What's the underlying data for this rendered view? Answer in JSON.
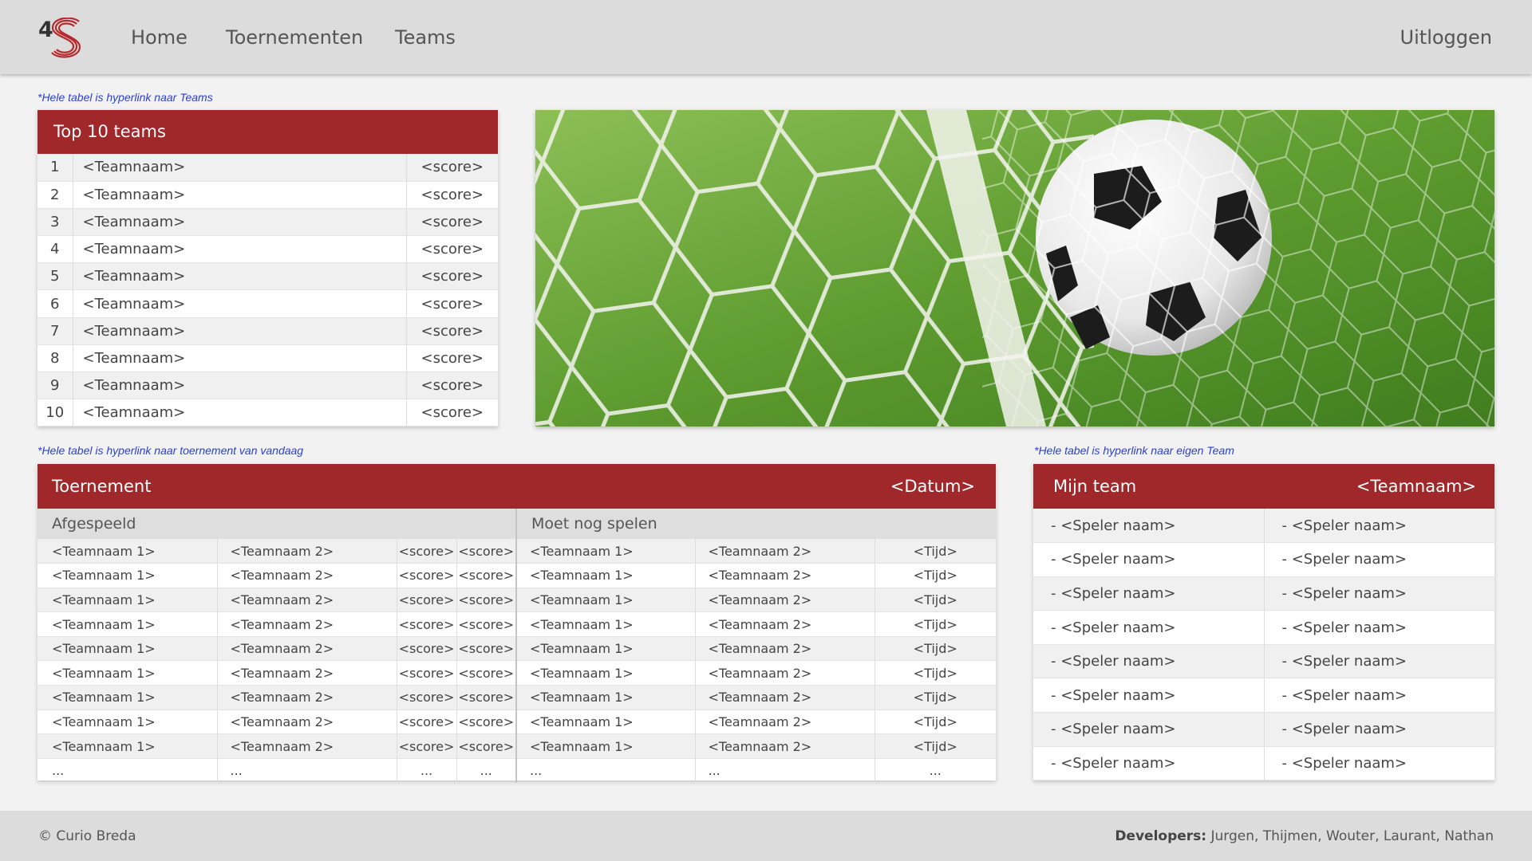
{
  "brand": {
    "logo_text": "4",
    "accent_color": "#a0282b"
  },
  "nav": {
    "home": "Home",
    "toernementen": "Toernementen",
    "teams": "Teams",
    "logout": "Uitloggen"
  },
  "notes": {
    "top10": "*Hele tabel is hyperlink naar Teams",
    "toernement": "*Hele tabel is hyperlink naar toernement van vandaag",
    "mijn_team": "*Hele tabel is hyperlink naar eigen Team"
  },
  "top10": {
    "title": "Top 10 teams",
    "rows": [
      {
        "rank": "1",
        "name": "<Teamnaam>",
        "score": "<score>"
      },
      {
        "rank": "2",
        "name": "<Teamnaam>",
        "score": "<score>"
      },
      {
        "rank": "3",
        "name": "<Teamnaam>",
        "score": "<score>"
      },
      {
        "rank": "4",
        "name": "<Teamnaam>",
        "score": "<score>"
      },
      {
        "rank": "5",
        "name": "<Teamnaam>",
        "score": "<score>"
      },
      {
        "rank": "6",
        "name": "<Teamnaam>",
        "score": "<score>"
      },
      {
        "rank": "7",
        "name": "<Teamnaam>",
        "score": "<score>"
      },
      {
        "rank": "8",
        "name": "<Teamnaam>",
        "score": "<score>"
      },
      {
        "rank": "9",
        "name": "<Teamnaam>",
        "score": "<score>"
      },
      {
        "rank": "10",
        "name": "<Teamnaam>",
        "score": "<score>"
      }
    ]
  },
  "toernement": {
    "title": "Toernement",
    "datum": "<Datum>",
    "afgespeeld_label": "Afgespeeld",
    "moet_nog_label": "Moet nog spelen",
    "rows": [
      [
        "<Teamnaam 1>",
        "<Teamnaam 2>",
        "<score>",
        "<score>",
        "<Teamnaam 1>",
        "<Teamnaam 2>",
        "<Tijd>"
      ],
      [
        "<Teamnaam 1>",
        "<Teamnaam 2>",
        "<score>",
        "<score>",
        "<Teamnaam 1>",
        "<Teamnaam 2>",
        "<Tijd>"
      ],
      [
        "<Teamnaam 1>",
        "<Teamnaam 2>",
        "<score>",
        "<score>",
        "<Teamnaam 1>",
        "<Teamnaam 2>",
        "<Tijd>"
      ],
      [
        "<Teamnaam 1>",
        "<Teamnaam 2>",
        "<score>",
        "<score>",
        "<Teamnaam 1>",
        "<Teamnaam 2>",
        "<Tijd>"
      ],
      [
        "<Teamnaam 1>",
        "<Teamnaam 2>",
        "<score>",
        "<score>",
        "<Teamnaam 1>",
        "<Teamnaam 2>",
        "<Tijd>"
      ],
      [
        "<Teamnaam 1>",
        "<Teamnaam 2>",
        "<score>",
        "<score>",
        "<Teamnaam 1>",
        "<Teamnaam 2>",
        "<Tijd>"
      ],
      [
        "<Teamnaam 1>",
        "<Teamnaam 2>",
        "<score>",
        "<score>",
        "<Teamnaam 1>",
        "<Teamnaam 2>",
        "<Tijd>"
      ],
      [
        "<Teamnaam 1>",
        "<Teamnaam 2>",
        "<score>",
        "<score>",
        "<Teamnaam 1>",
        "<Teamnaam 2>",
        "<Tijd>"
      ],
      [
        "<Teamnaam 1>",
        "<Teamnaam 2>",
        "<score>",
        "<score>",
        "<Teamnaam 1>",
        "<Teamnaam 2>",
        "<Tijd>"
      ],
      [
        "...",
        "...",
        "...",
        "...",
        "...",
        "...",
        "..."
      ]
    ]
  },
  "mijn_team": {
    "title": "Mijn team",
    "teamnaam": "<Teamnaam>",
    "rows": [
      [
        "- <Speler naam>",
        "- <Speler naam>"
      ],
      [
        "- <Speler naam>",
        "- <Speler naam>"
      ],
      [
        "- <Speler naam>",
        "- <Speler naam>"
      ],
      [
        "- <Speler naam>",
        "- <Speler naam>"
      ],
      [
        "- <Speler naam>",
        "- <Speler naam>"
      ],
      [
        "- <Speler naam>",
        "- <Speler naam>"
      ],
      [
        "- <Speler naam>",
        "- <Speler naam>"
      ],
      [
        "- <Speler naam>",
        "- <Speler naam>"
      ]
    ]
  },
  "footer": {
    "copyright": "© Curio Breda",
    "developers_label": "Developers:",
    "developers": "Jurgen, Thijmen, Wouter, Laurant, Nathan"
  }
}
